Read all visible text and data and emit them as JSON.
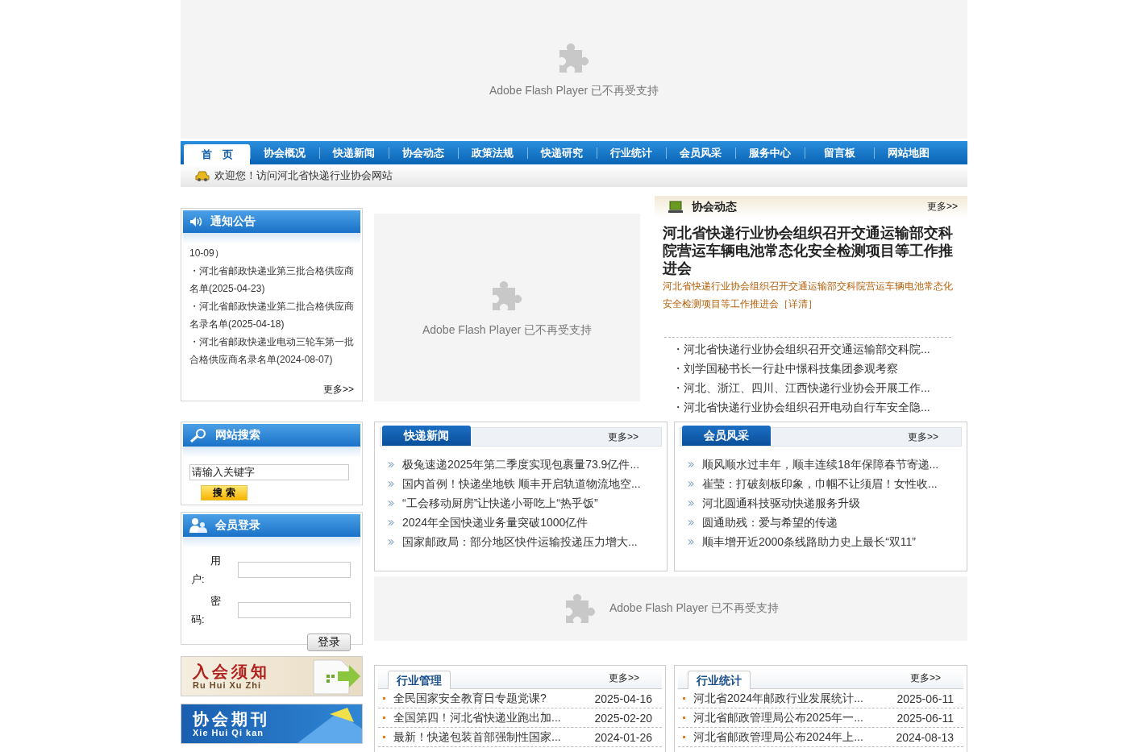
{
  "top_flash": {
    "message": "Adobe Flash Player 已不再受支持"
  },
  "nav": [
    {
      "label": "首　页",
      "selected": true
    },
    {
      "label": "协会概况",
      "selected": false
    },
    {
      "label": "快递新闻",
      "selected": false
    },
    {
      "label": "协会动态",
      "selected": false
    },
    {
      "label": "政策法规",
      "selected": false
    },
    {
      "label": "快递研究",
      "selected": false
    },
    {
      "label": "行业统计",
      "selected": false
    },
    {
      "label": "会员风采",
      "selected": false
    },
    {
      "label": "服务中心",
      "selected": false
    },
    {
      "label": "留言板",
      "selected": false
    },
    {
      "label": "网站地图",
      "selected": false
    }
  ],
  "welcome": "欢迎您！访问河北省快递行业协会网站",
  "notice": {
    "title": "通知公告",
    "items": [
      "10-09）",
      "・河北省邮政快递业第三批合格供应商名单(2025-04-23)",
      "・河北省邮政快递业第二批合格供应商名录名单(2025-04-18)",
      "・河北省邮政快递业电动三轮车第一批合格供应商名录名单(2024-08-07)"
    ],
    "more": "更多>>"
  },
  "search": {
    "title": "网站搜索",
    "value": "请输入关键字",
    "button": "搜 索"
  },
  "login": {
    "title": "会员登录",
    "fields": [
      {
        "label": "用户:"
      },
      {
        "label": "密码:"
      }
    ],
    "button": "登录"
  },
  "promos": [
    {
      "title": "入会须知",
      "subtitle": "Ru Hui Xu Zhi",
      "kind": "join"
    },
    {
      "title": "协会期刊",
      "subtitle": "Xie Hui Qi kan",
      "kind": "journal"
    }
  ],
  "middle_flash": {
    "message": "Adobe Flash Player 已不再受支持"
  },
  "association_news": {
    "title": "协会动态",
    "more": "更多>>",
    "headline": "河北省快递行业协会组织召开交通运输部交科院营运车辆电池常态化安全检测项目等工作推进会",
    "summary": "河北省快递行业协会组织召开交通运输部交科院营运车辆电池常态化安全检测项目等工作推进会",
    "detail": "［详清］",
    "items": [
      "・河北省快递行业协会组织召开交通运输部交科院...",
      "・刘学国秘书长一行赴中憬科技集团参观考察",
      "・河北、浙江、四川、江西快递行业协会开展工作...",
      "・河北省快递行业协会组织召开电动自行车安全隐..."
    ]
  },
  "express_news": {
    "title": "快递新闻",
    "more": "更多>>",
    "items": [
      "极兔速递2025年第二季度实现包裹量73.9亿件...",
      "国内首例！快递坐地铁 顺丰开启轨道物流地空...",
      "“工会移动厨房”让快递小哥吃上“热乎饭”",
      "2024年全国快递业务量突破1000亿件",
      "国家邮政局：部分地区快件运输投递压力增大..."
    ]
  },
  "member_style": {
    "title": "会员风采",
    "more": "更多>>",
    "items": [
      "顺风顺水过丰年，顺丰连续18年保障春节寄递...",
      "崔莹：打破刻板印象，巾帼不让须眉！女性收...",
      "河北圆通科技驱动快递服务升级",
      "圆通助残：爱与希望的传递",
      "顺丰增开近2000条线路助力史上最长“双11”"
    ]
  },
  "bottom_flash": {
    "message": "Adobe Flash Player 已不再受支持"
  },
  "industry_management": {
    "title": "行业管理",
    "more": "更多>>",
    "rows": [
      {
        "title": "全民国家安全教育日专题党课?",
        "date": "2025-04-16"
      },
      {
        "title": "全国第四！河北省快递业跑出加...",
        "date": "2025-02-20"
      },
      {
        "title": "最新！快递包装首部强制性国家...",
        "date": "2024-01-26"
      }
    ]
  },
  "industry_statistics": {
    "title": "行业统计",
    "more": "更多>>",
    "rows": [
      {
        "title": "河北省2024年邮政行业发展统计...",
        "date": "2025-06-11"
      },
      {
        "title": "河北省邮政管理局公布2025年一...",
        "date": "2025-06-11"
      },
      {
        "title": "河北省邮政管理局公布2024年上...",
        "date": "2024-08-13"
      }
    ]
  }
}
